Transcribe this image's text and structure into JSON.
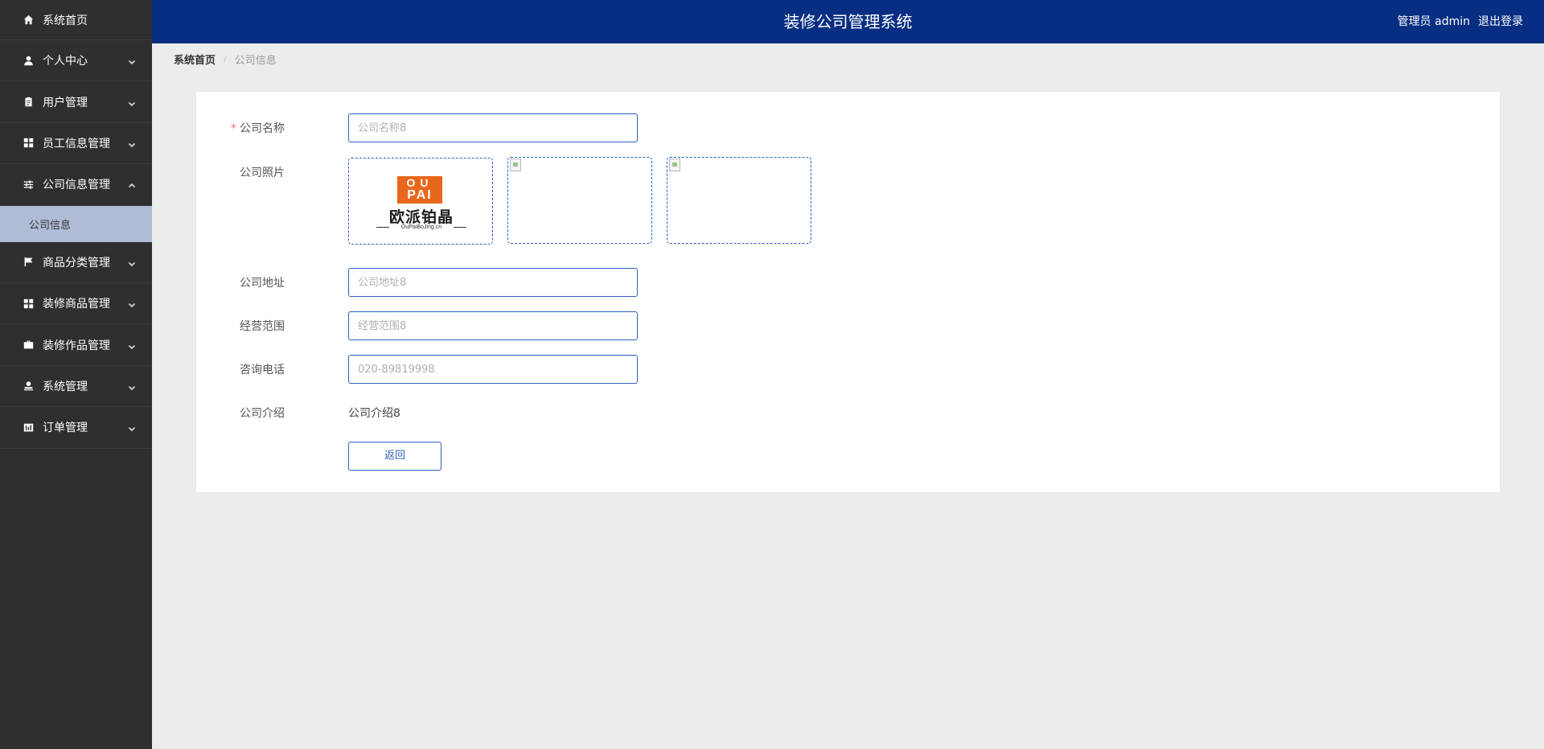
{
  "header": {
    "title": "装修公司管理系统",
    "user": "管理员 admin",
    "logout": "退出登录"
  },
  "sidebar": {
    "items": [
      {
        "label": "系统首页",
        "icon": "home-icon"
      },
      {
        "label": "个人中心",
        "icon": "user-icon"
      },
      {
        "label": "用户管理",
        "icon": "clipboard-icon"
      },
      {
        "label": "员工信息管理",
        "icon": "grid-icon"
      },
      {
        "label": "公司信息管理",
        "icon": "sliders-icon"
      },
      {
        "label": "商品分类管理",
        "icon": "flag-icon"
      },
      {
        "label": "装修商品管理",
        "icon": "grid-icon"
      },
      {
        "label": "装修作品管理",
        "icon": "briefcase-icon"
      },
      {
        "label": "系统管理",
        "icon": "person-stamp-icon"
      },
      {
        "label": "订单管理",
        "icon": "bar-chart-icon"
      }
    ],
    "submenu": {
      "label": "公司信息"
    }
  },
  "breadcrumb": {
    "home": "系统首页",
    "separator": "/",
    "current": "公司信息"
  },
  "form": {
    "company_name": {
      "label": "公司名称",
      "required": "*",
      "placeholder": "公司名称8"
    },
    "company_photos": {
      "label": "公司照片",
      "logo": {
        "top_line1": "OU",
        "top_line2": "PAI",
        "cn": "欧派铂晶",
        "sub": "OuPaiBoJing.cn"
      }
    },
    "company_address": {
      "label": "公司地址",
      "placeholder": "公司地址8"
    },
    "business_scope": {
      "label": "经营范围",
      "placeholder": "经营范围8"
    },
    "phone": {
      "label": "咨询电话",
      "placeholder": "020-89819998"
    },
    "intro": {
      "label": "公司介绍",
      "value": "公司介绍8"
    },
    "back_button": "返回"
  },
  "colors": {
    "header_bg": "#072e82",
    "sidebar_bg": "#2f2f2f",
    "submenu_active_bg": "#b0bcd6",
    "accent_border": "#2c5fbf",
    "logo_orange": "#e8671c",
    "required": "#f56c6c"
  }
}
